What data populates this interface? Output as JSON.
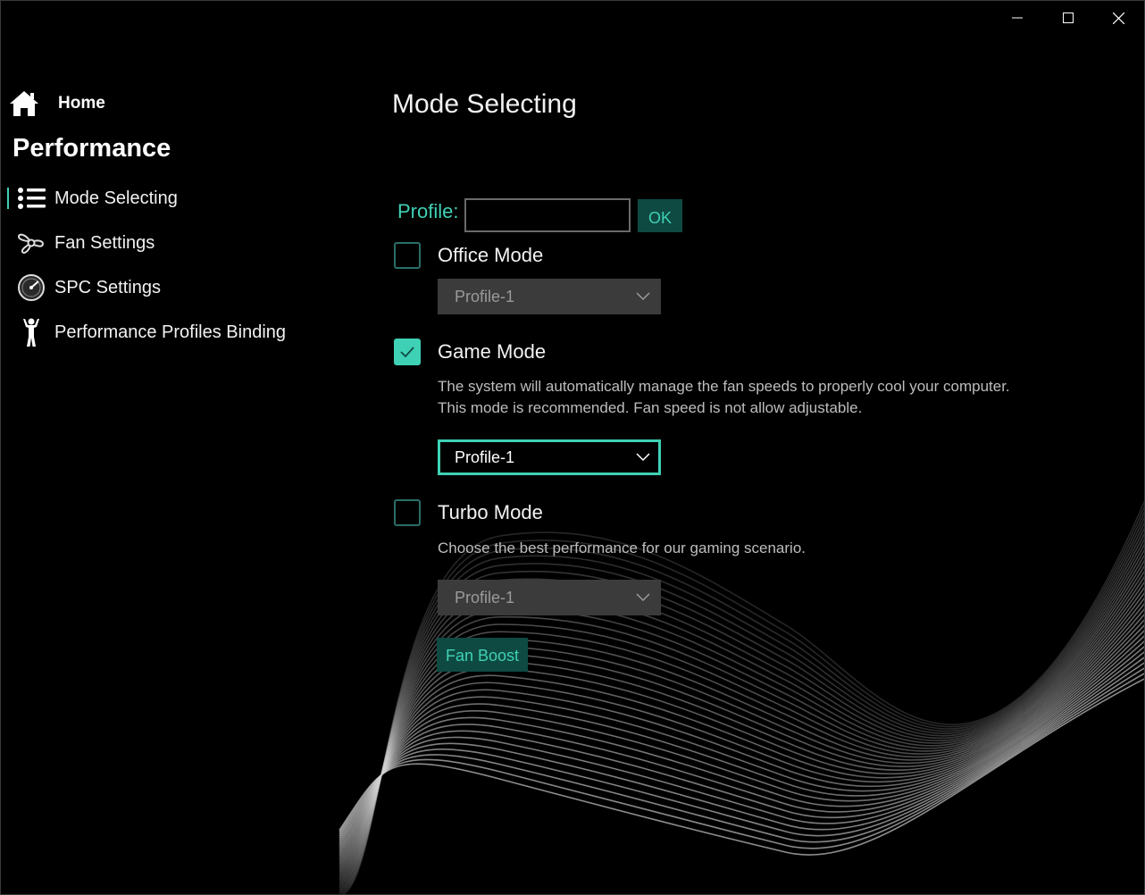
{
  "window": {
    "minimize_icon": "minimize-icon",
    "maximize_icon": "maximize-icon",
    "close_icon": "close-icon"
  },
  "sidebar": {
    "home_label": "Home",
    "section_title": "Performance",
    "items": [
      {
        "label": "Mode Selecting",
        "icon": "list-icon",
        "selected": true
      },
      {
        "label": "Fan Settings",
        "icon": "fan-icon",
        "selected": false
      },
      {
        "label": "SPC Settings",
        "icon": "gauge-icon",
        "selected": false
      },
      {
        "label": "Performance Profiles Binding",
        "icon": "person-icon",
        "selected": false
      }
    ]
  },
  "main": {
    "title": "Mode Selecting",
    "profile": {
      "label": "Profile:",
      "value": "",
      "ok_label": "OK"
    },
    "modes": [
      {
        "label": "Office Mode",
        "checked": false,
        "description": "",
        "profile": "Profile-1",
        "enabled": false
      },
      {
        "label": "Game Mode",
        "checked": true,
        "description_line1": "The system will automatically manage the fan speeds to properly cool your computer.",
        "description_line2": "This mode is recommended. Fan speed is not allow adjustable.",
        "profile": "Profile-1",
        "enabled": true
      },
      {
        "label": "Turbo Mode",
        "checked": false,
        "description": "Choose the best performance for our gaming scenario.",
        "profile": "Profile-1",
        "enabled": false
      }
    ],
    "fan_boost_label": "Fan Boost"
  },
  "colors": {
    "accent": "#3fd1b5",
    "accent_dark": "#0e4a42",
    "background": "#000000",
    "disabled": "#3b3b3b"
  }
}
